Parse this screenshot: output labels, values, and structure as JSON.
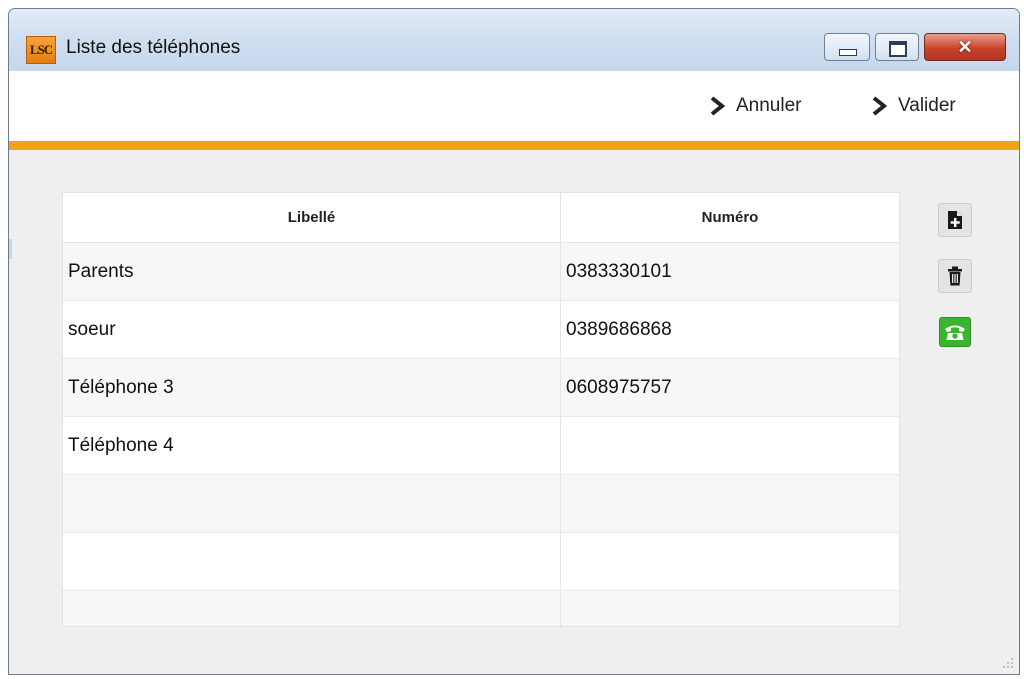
{
  "window": {
    "title": "Liste des téléphones",
    "app_icon_text": "LSC",
    "controls": [
      "minimize-icon",
      "maximize-icon",
      "close-icon"
    ],
    "close_glyph": "✕"
  },
  "toolbar": {
    "cancel_label": "Annuler",
    "validate_label": "Valider",
    "accent_color": "#f5a21a"
  },
  "grid": {
    "columns": [
      "Libellé",
      "Numéro"
    ],
    "rows": [
      {
        "libelle": "Parents",
        "numero": "0383330101"
      },
      {
        "libelle": "soeur",
        "numero": "0389686868"
      },
      {
        "libelle": "Téléphone 3",
        "numero": "0608975757"
      },
      {
        "libelle": "Téléphone 4",
        "numero": ""
      },
      {
        "libelle": "",
        "numero": ""
      },
      {
        "libelle": "",
        "numero": ""
      },
      {
        "libelle": "",
        "numero": ""
      }
    ]
  },
  "side_actions": [
    {
      "name": "add-document-icon"
    },
    {
      "name": "trash-icon"
    },
    {
      "name": "phone-icon",
      "color": "#3bb52f"
    }
  ]
}
